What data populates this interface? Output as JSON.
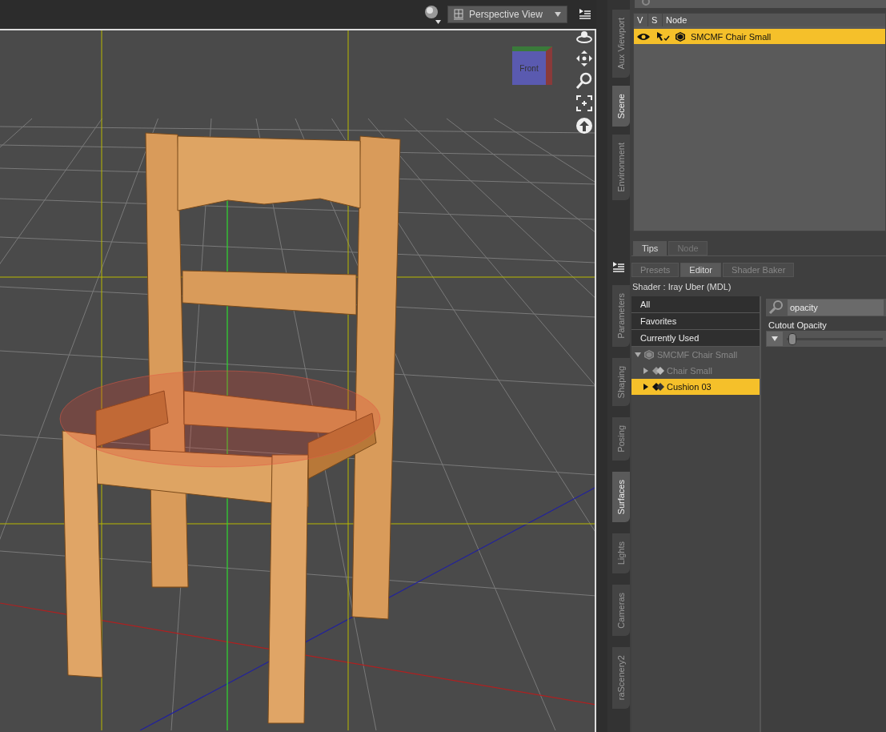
{
  "viewport": {
    "view_dropdown": {
      "value": "Perspective View"
    },
    "nav_cube": {
      "label": "Front"
    }
  },
  "side_tabs_top": [
    {
      "label": "Aux Viewport",
      "selected": false
    },
    {
      "label": "Scene",
      "selected": true
    },
    {
      "label": "Environment",
      "selected": false
    }
  ],
  "scene": {
    "columns": [
      "V",
      "S",
      "Node"
    ],
    "rows": [
      {
        "name": "SMCMF Chair Small",
        "selected": true
      }
    ]
  },
  "info_tabs": [
    {
      "label": "Tips",
      "selected": true
    },
    {
      "label": "Node",
      "selected": false
    }
  ],
  "side_tabs_bottom": [
    {
      "label": "Parameters",
      "selected": false
    },
    {
      "label": "Shaping",
      "selected": false
    },
    {
      "label": "Posing",
      "selected": false
    },
    {
      "label": "Surfaces",
      "selected": true
    },
    {
      "label": "Lights",
      "selected": false
    },
    {
      "label": "Cameras",
      "selected": false
    },
    {
      "label": "raScenery2",
      "selected": false
    }
  ],
  "surfaces": {
    "tabs": [
      {
        "label": "Presets",
        "selected": false
      },
      {
        "label": "Editor",
        "selected": true
      },
      {
        "label": "Shader Baker",
        "selected": false
      }
    ],
    "shader": "Shader : Iray Uber (MDL)",
    "filters": [
      "All",
      "Favorites",
      "Currently Used"
    ],
    "tree": [
      {
        "label": "SMCMF Chair Small",
        "selected": false,
        "expanded": true,
        "children": [
          {
            "label": "Chair Small",
            "selected": false,
            "expanded": false
          },
          {
            "label": "Cushion 03",
            "selected": true,
            "expanded": false
          }
        ]
      }
    ],
    "search": {
      "value": "opacity"
    },
    "property": {
      "label": "Cutout Opacity",
      "level": 0.02
    }
  }
}
